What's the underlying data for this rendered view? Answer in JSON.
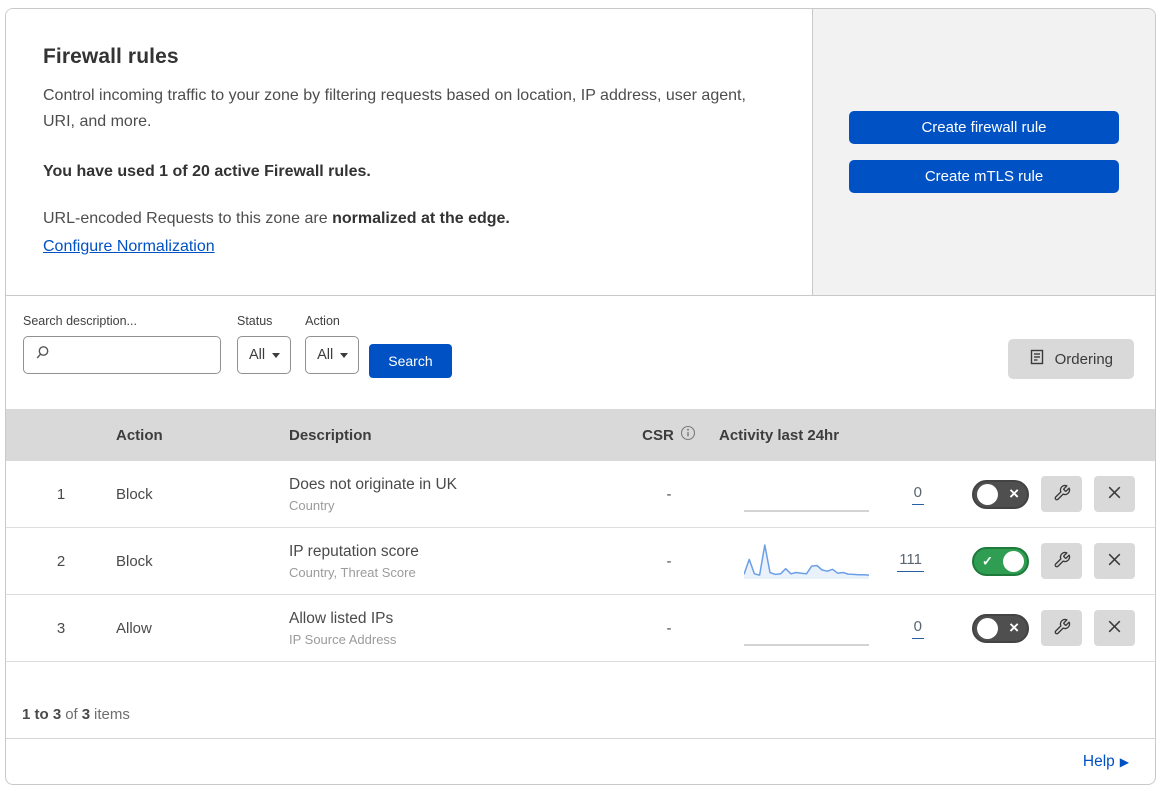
{
  "panel": {
    "title": "Firewall rules",
    "description": "Control incoming traffic to your zone by filtering requests based on location, IP address, user agent, URI, and more.",
    "usage_text": "You have used 1 of 20 active Firewall rules.",
    "normalization_prefix": "URL-encoded Requests to this zone are ",
    "normalization_bold": "normalized at the edge.",
    "normalization_link": "Configure Normalization",
    "create_firewall_button": "Create firewall rule",
    "create_mtls_button": "Create mTLS rule"
  },
  "filters": {
    "search_label": "Search description...",
    "status_label": "Status",
    "status_value": "All",
    "action_label": "Action",
    "action_value": "All",
    "search_button": "Search",
    "ordering_button": "Ordering"
  },
  "table": {
    "headers": {
      "action": "Action",
      "description": "Description",
      "csr": "CSR",
      "activity": "Activity last 24hr"
    },
    "rows": [
      {
        "num": "1",
        "action": "Block",
        "title": "Does not originate in UK",
        "subtitle": "Country",
        "csr": "-",
        "count": "0",
        "enabled": false,
        "sparkline": []
      },
      {
        "num": "2",
        "action": "Block",
        "title": "IP reputation score",
        "subtitle": "Country, Threat Score",
        "csr": "-",
        "count": "111",
        "enabled": true,
        "sparkline": [
          8,
          55,
          10,
          6,
          100,
          14,
          8,
          10,
          26,
          10,
          14,
          12,
          10,
          34,
          36,
          22,
          18,
          24,
          12,
          14,
          9,
          8,
          7,
          7,
          6
        ]
      },
      {
        "num": "3",
        "action": "Allow",
        "title": "Allow listed IPs",
        "subtitle": "IP Source Address",
        "csr": "-",
        "count": "0",
        "enabled": false,
        "sparkline": []
      }
    ]
  },
  "footer": {
    "range_bold": "1 to 3",
    "of": "of",
    "total_bold": "3",
    "items": "items"
  },
  "help": {
    "label": "Help"
  },
  "colors": {
    "accent_blue": "#0051c3",
    "toggle_on_green": "#2f9e53",
    "toggle_off_gray": "#4f4f4f",
    "table_header_gray": "#d9d9d9",
    "side_panel_gray": "#f2f2f2",
    "sparkline_blue": "#6b9fe8"
  }
}
